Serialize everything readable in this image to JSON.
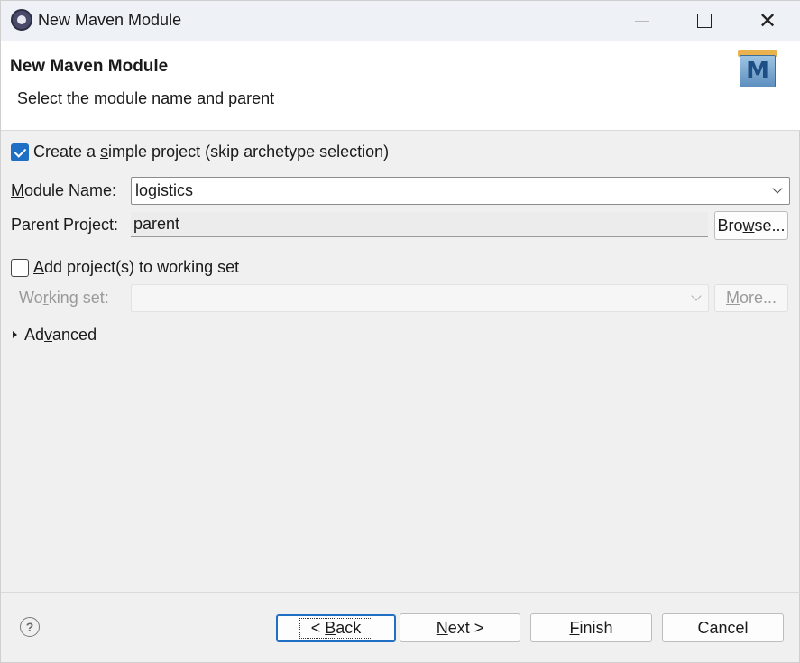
{
  "window": {
    "title": "New Maven Module",
    "controls": {
      "minimize_icon": "minimize-icon",
      "maximize_icon": "maximize-icon",
      "close_glyph": "✕"
    }
  },
  "header": {
    "title": "New Maven Module",
    "subtitle": "Select the module name and parent",
    "logo_letter": "M"
  },
  "form": {
    "simple_project": {
      "checked": true,
      "prefix": "Create a ",
      "mnemonic": "s",
      "suffix": "imple project (skip archetype selection)"
    },
    "module_name": {
      "label_mnemonic": "M",
      "label_rest": "odule Name:",
      "value": "logistics"
    },
    "parent_project": {
      "label": "Parent Project:",
      "value": "parent",
      "browse_prefix": "Bro",
      "browse_mnemonic": "w",
      "browse_suffix": "se..."
    },
    "working_set_checkbox": {
      "checked": false,
      "mnemonic": "A",
      "rest": "dd project(s) to working set"
    },
    "working_set": {
      "label_prefix": "Wo",
      "label_mnemonic": "r",
      "label_suffix": "king set:",
      "value": "",
      "more_prefix": "",
      "more_mnemonic": "M",
      "more_suffix": "ore..."
    },
    "advanced": {
      "prefix": "Ad",
      "mnemonic": "v",
      "suffix": "anced"
    }
  },
  "footer": {
    "help_glyph": "?",
    "back": {
      "prefix": "< ",
      "mnemonic": "B",
      "suffix": "ack"
    },
    "next": {
      "prefix": "",
      "mnemonic": "N",
      "suffix": "ext >"
    },
    "finish": {
      "prefix": "",
      "mnemonic": "F",
      "suffix": "inish"
    },
    "cancel": "Cancel"
  }
}
